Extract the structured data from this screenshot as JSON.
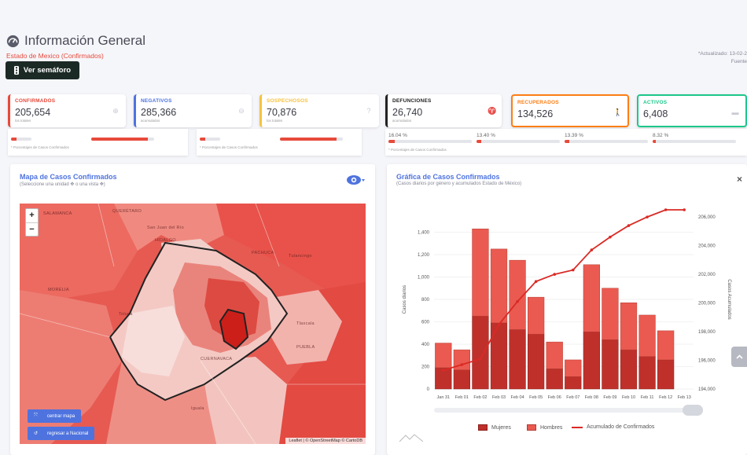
{
  "header": {
    "title": "Información General",
    "subtitle": "Estado de Mexico (Confirmados)",
    "semaforo_button": "Ver semáforo",
    "updated": "*Actualizado: 13-02-2",
    "source": "Fuente"
  },
  "stats": [
    {
      "label": "CONFIRMADOS",
      "value": "205,654",
      "sub": "los totales",
      "color": "#e74a3b",
      "icon": "plus-circle-icon"
    },
    {
      "label": "NEGATIVOS",
      "value": "285,366",
      "sub": "acumulados",
      "color": "#4e73df",
      "icon": "minus-circle-icon"
    },
    {
      "label": "SOSPECHOSOS",
      "value": "70,876",
      "sub": "los totales",
      "color": "#f6c23e",
      "icon": "question-circle-icon"
    },
    {
      "label": "DEFUNCIONES",
      "value": "26,740",
      "sub": "acumulados",
      "color": "#222222",
      "icon": "ribbon-icon"
    },
    {
      "label": "RECUPERADOS",
      "value": "134,526",
      "sub": "",
      "color": "#fd7e14",
      "icon": "walking-icon"
    },
    {
      "label": "ACTIVOS",
      "value": "6,408",
      "sub": "",
      "color": "#1cc88a",
      "icon": "bed-icon"
    }
  ],
  "strip": {
    "note": "* Porcentajes de Casos Confirmados",
    "pcts": [
      "16.04 %",
      "13.40 %",
      "13.39 %",
      "8.32 %"
    ],
    "bar_levels": [
      0.25,
      0.9,
      0.25,
      0.9,
      0.08,
      0.06,
      0.06,
      0.04
    ]
  },
  "map_panel": {
    "title": "Mapa de Casos Confirmados",
    "subtitle": "(Seleccione una unidad ✥ o una vista ✥)",
    "zoom_in": "+",
    "zoom_out": "−",
    "center_button": "centrar mapa",
    "national_button": "regresar a Nacional",
    "attribution": "Leaflet | © OpenStreetMap © CartoDB",
    "places": [
      "SALAMANCA",
      "QUERÉTARO",
      "San Juan del Río",
      "HIDALGO",
      "PACHUCA",
      "Tulancingo",
      "MORELIA",
      "Toluca",
      "Tlaxcala",
      "PUEBLA",
      "CUERNAVACA",
      "Iguala"
    ]
  },
  "chart_panel": {
    "title": "Gráfica de Casos Confirmados",
    "subtitle": "(Casos diarios por género y acumulados Estado de México)",
    "close": "×"
  },
  "chart_data": {
    "type": "bar",
    "categories": [
      "Jan 31",
      "Feb 01",
      "Feb 02",
      "Feb 03",
      "Feb 04",
      "Feb 05",
      "Feb 06",
      "Feb 07",
      "Feb 08",
      "Feb 09",
      "Feb 10",
      "Feb 11",
      "Feb 12",
      "Feb 13"
    ],
    "series": [
      {
        "name": "Mujeres",
        "type": "bar",
        "color": "#c0302b",
        "values": [
          190,
          170,
          650,
          590,
          530,
          490,
          180,
          110,
          510,
          440,
          350,
          290,
          260,
          0
        ]
      },
      {
        "name": "Hombres",
        "type": "bar",
        "color": "#ea5a50",
        "values": [
          220,
          180,
          780,
          660,
          620,
          330,
          240,
          150,
          600,
          460,
          420,
          370,
          260,
          0
        ]
      },
      {
        "name": "Acumulado de Confirmados",
        "type": "line",
        "color": "#d92a25",
        "axis": "right",
        "values": [
          195300,
          195700,
          196100,
          198500,
          200100,
          201500,
          202000,
          202300,
          203700,
          204600,
          205400,
          206000,
          206500,
          206500
        ]
      }
    ],
    "ylabel": "Casos diarios",
    "ylabel_right": "Casos Acumulados",
    "ylim": [
      0,
      1600
    ],
    "ylim_right": [
      194000,
      206500
    ],
    "yticks": [
      "0",
      "200",
      "400",
      "600",
      "800",
      "1,000",
      "1,200",
      "1,400"
    ],
    "yticks_right": [
      "194,000",
      "196,000",
      "198,000",
      "200,000",
      "202,000",
      "204,000",
      "206,000"
    ],
    "legend": "bottom"
  }
}
